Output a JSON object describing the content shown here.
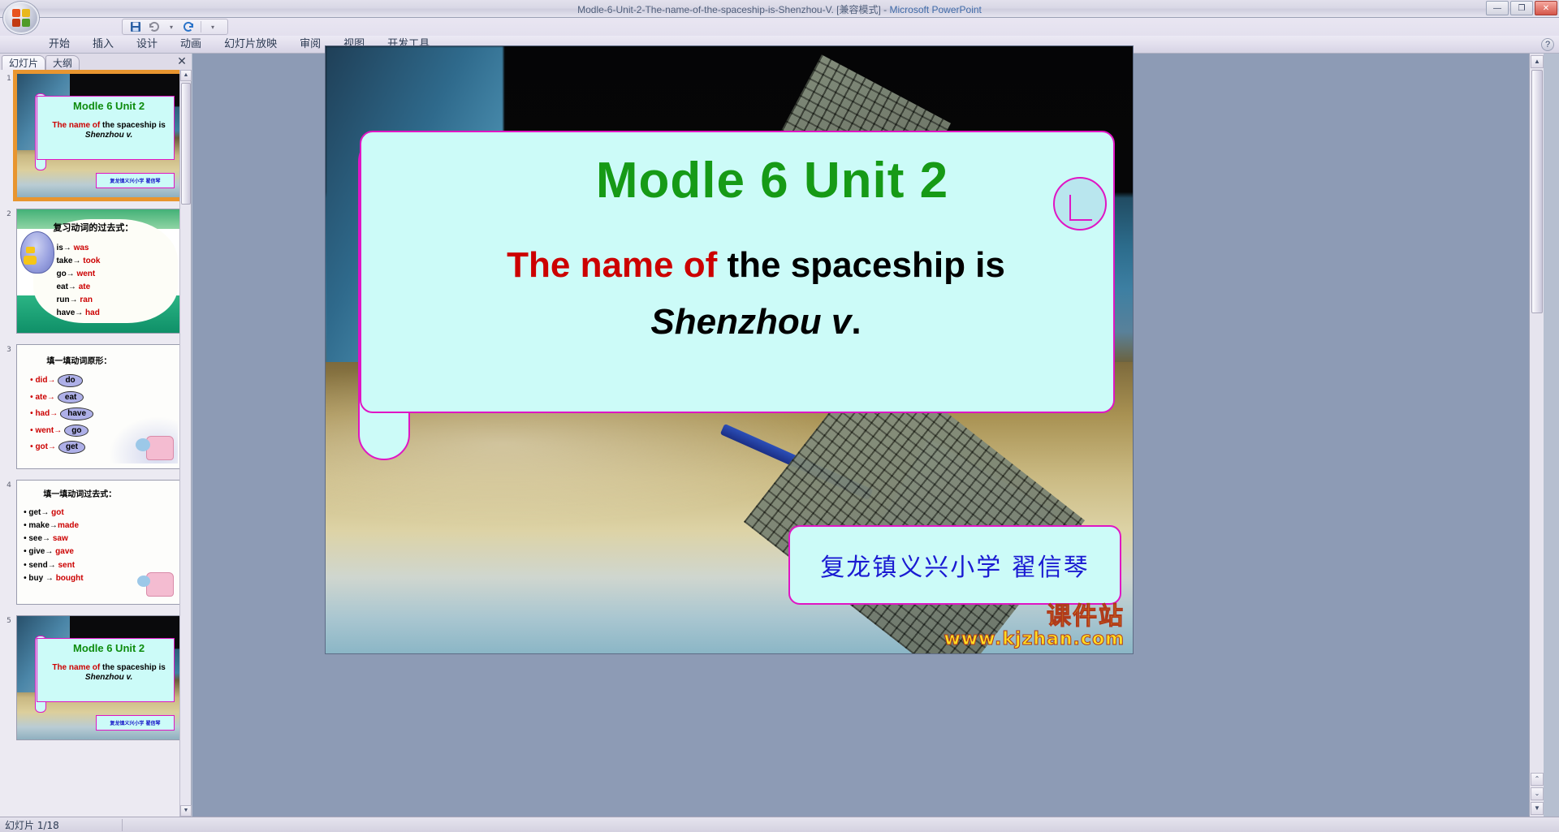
{
  "window": {
    "title_main": "Modle-6-Unit-2-The-name-of-the-spaceship-is-Shenzhou-V. [兼容模式]",
    "title_sep": " - ",
    "title_app": "Microsoft PowerPoint",
    "minimize": "—",
    "restore": "❐",
    "close": "✕"
  },
  "quick_access": {
    "save_icon": "save-icon",
    "undo_icon": "undo-icon",
    "undo_caret": "▾",
    "redo_icon": "redo-icon",
    "customize_caret": "▾"
  },
  "office_button": {
    "label": "office-orb"
  },
  "ribbon_tabs": [
    {
      "label": "开始"
    },
    {
      "label": "插入"
    },
    {
      "label": "设计"
    },
    {
      "label": "动画"
    },
    {
      "label": "幻灯片放映"
    },
    {
      "label": "审阅"
    },
    {
      "label": "视图"
    },
    {
      "label": "开发工具"
    }
  ],
  "help_button": {
    "label": "?"
  },
  "left_panel": {
    "tabs": [
      {
        "label": "幻灯片"
      },
      {
        "label": "大纲"
      }
    ],
    "close_label": "✕",
    "scroll_up": "▲",
    "scroll_down": "▼"
  },
  "thumbnails": [
    {
      "number": "1",
      "selected": true,
      "type": "title",
      "heading": "Modle 6 Unit 2",
      "line_red": "The name of",
      "line_black": " the spaceship is",
      "line_italic": "Shenzhou v.",
      "credit": "复龙镇义兴小学 翟信琴"
    },
    {
      "number": "2",
      "selected": false,
      "type": "list-bird",
      "heading": "复习动词的过去式：",
      "items": [
        {
          "left": "is→ ",
          "right": "was"
        },
        {
          "left": "take→ ",
          "right": "took"
        },
        {
          "left": "go→ ",
          "right": "went"
        },
        {
          "left": "eat→ ",
          "right": "ate"
        },
        {
          "left": "run→ ",
          "right": "ran"
        },
        {
          "left": "have→ ",
          "right": "had"
        }
      ]
    },
    {
      "number": "3",
      "selected": false,
      "type": "list-oval",
      "heading": "填一填动词原形：",
      "items": [
        {
          "left": "did→",
          "oval": "do"
        },
        {
          "left": "ate→",
          "oval": "eat"
        },
        {
          "left": "had→",
          "oval": "have"
        },
        {
          "left": "went→",
          "oval": "go"
        },
        {
          "left": "got→",
          "oval": "get"
        }
      ]
    },
    {
      "number": "4",
      "selected": false,
      "type": "list-past",
      "heading": "填一填动词过去式：",
      "items": [
        {
          "left": "get→  ",
          "right": "got"
        },
        {
          "left": "make→",
          "right": "made"
        },
        {
          "left": "see→ ",
          "right": "saw"
        },
        {
          "left": "give→ ",
          "right": "gave"
        },
        {
          "left": "send→ ",
          "right": "sent"
        },
        {
          "left": "buy → ",
          "right": "bought"
        }
      ]
    },
    {
      "number": "5",
      "selected": false,
      "type": "title",
      "heading": "Modle 6 Unit 2",
      "line_red": "The name of",
      "line_black": " the spaceship is",
      "line_italic": "Shenzhou v.",
      "credit": "复龙镇义兴小学 翟信琴"
    }
  ],
  "slide": {
    "heading": "Modle 6 Unit 2",
    "sub_red": "The name of",
    "sub_black": " the spaceship is",
    "sub_italic": "Shenzhou v",
    "sub_period": ".",
    "credit": "复龙镇义兴小学 翟信琴",
    "watermark_cn": "课件站",
    "watermark_url": "www.kjzhan.com"
  },
  "stage_scrollbar": {
    "up": "▲",
    "down": "▼",
    "prev_slide": "⌃",
    "next_slide": "⌄"
  },
  "status_bar": {
    "slide_count": "幻灯片 1/18"
  },
  "colors": {
    "heading_green": "#169a16",
    "accent_red": "#cc0000",
    "panel_cyan": "#ccfbf8",
    "border_magenta": "#e015c4",
    "credit_blue": "#1a1ad2",
    "watermark_yellow": "#ffdd22",
    "selection_orange": "#e8952f"
  }
}
